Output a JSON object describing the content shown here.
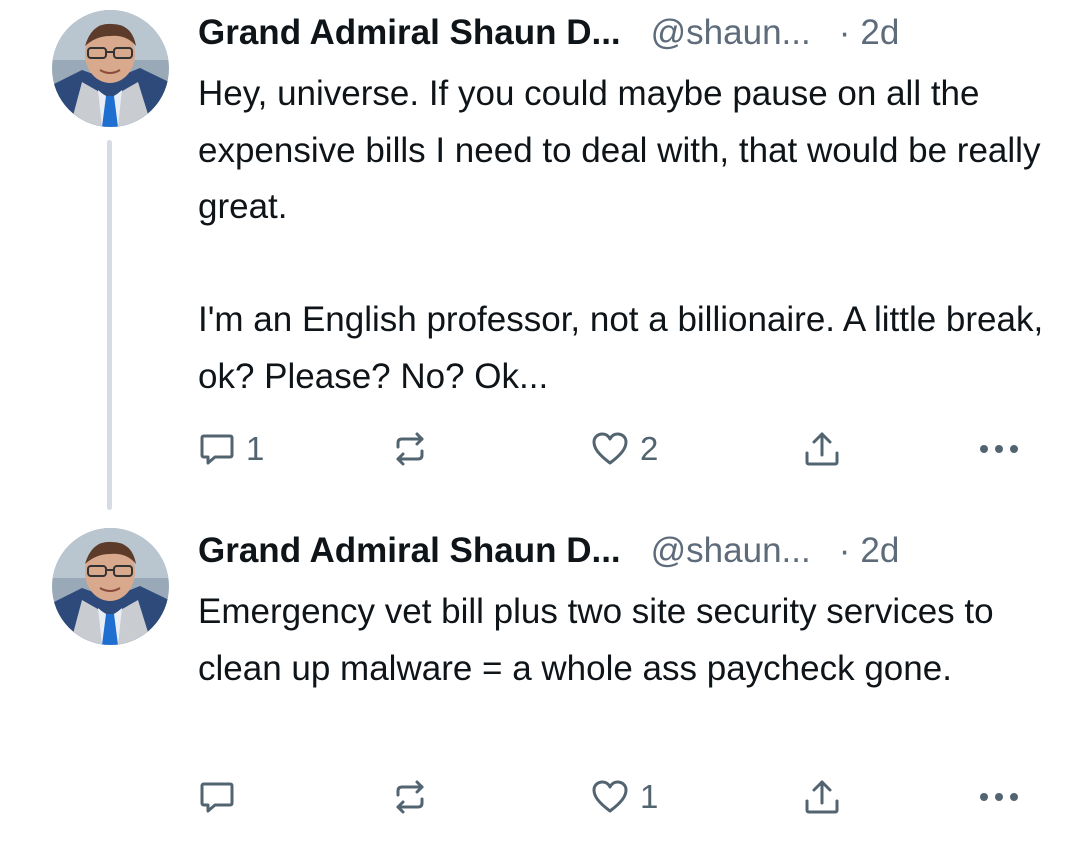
{
  "posts": [
    {
      "author": "Grand Admiral Shaun D...",
      "handle": "@shaun...",
      "separator": "·",
      "time": "2d",
      "text": "Hey, universe. If you could maybe pause on all the expensive bills I need to deal with, that would be really great.\n\nI'm an English professor, not a billionaire. A little break, ok? Please? No? Ok...",
      "reply_count": "1",
      "like_count": "2"
    },
    {
      "author": "Grand Admiral Shaun D...",
      "handle": "@shaun...",
      "separator": "·",
      "time": "2d",
      "text": "Emergency vet bill plus two site security services to clean up malware = a whole ass paycheck gone.",
      "reply_count": "",
      "like_count": "1"
    }
  ],
  "icons": {
    "reply": "speech-bubble-icon",
    "repost": "repost-arrows-icon",
    "like": "heart-icon",
    "share": "share-upload-icon",
    "more": "ellipsis-icon"
  },
  "colors": {
    "text": "#0f1419",
    "muted": "#5d6b7a",
    "icon": "#536471",
    "thread_line": "#d7dbe3"
  }
}
